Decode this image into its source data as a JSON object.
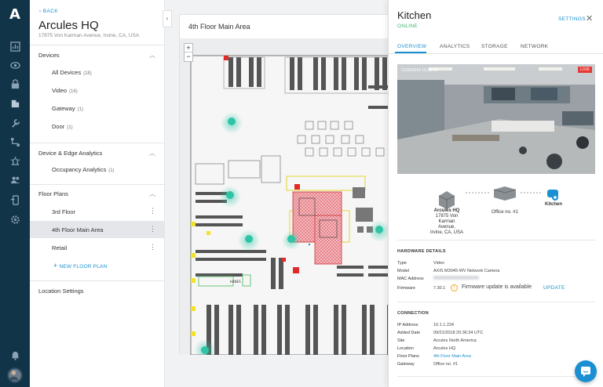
{
  "rail": {
    "logo": "A",
    "icons": [
      "chart-icon",
      "eye-icon",
      "lock-icon",
      "building-icon",
      "wrench-icon",
      "flow-icon",
      "alarm-icon",
      "users-icon",
      "device-icon",
      "gear-icon",
      "bell-icon"
    ]
  },
  "sidebar": {
    "back_label": "BACK",
    "site_name": "Arcules HQ",
    "site_address": "17875 Von Karman Avenue, Irvine, CA, USA",
    "sections": {
      "devices": {
        "title": "Devices",
        "items": [
          {
            "label": "All Devices",
            "count": "(18)"
          },
          {
            "label": "Video",
            "count": "(16)"
          },
          {
            "label": "Gateway",
            "count": "(1)"
          },
          {
            "label": "Door",
            "count": "(1)"
          }
        ]
      },
      "analytics": {
        "title": "Device & Edge Analytics",
        "items": [
          {
            "label": "Occupancy Analytics",
            "count": "(1)"
          }
        ]
      },
      "floor_plans": {
        "title": "Floor Plans",
        "items": [
          {
            "label": "3rd Floor"
          },
          {
            "label": "4th Floor Main Area"
          },
          {
            "label": "Retail"
          }
        ],
        "new_label": "NEW FLOOR PLAN"
      }
    },
    "location_settings": "Location Settings"
  },
  "map": {
    "title": "4th Floor Main Area",
    "zoom_in": "+",
    "zoom_out": "−"
  },
  "panel": {
    "title": "Kitchen",
    "status": "ONLINE",
    "settings_label": "SETTINGS",
    "close": "✕",
    "tabs": [
      "OVERVIEW",
      "ANALYTICS",
      "STORAGE",
      "NETWORK"
    ],
    "video": {
      "live_label": "LIVE",
      "timestamp": "21/09/2018 10:35:43"
    },
    "topology": {
      "site_name": "Arcules HQ",
      "site_addr_1": "17875 Von",
      "site_addr_2": "Karman Avenue,",
      "site_addr_3": "Irvine, CA, USA",
      "gateway": "Office no. #1",
      "camera": "Kitchen"
    },
    "hardware": {
      "title": "HARDWARE DETAILS",
      "type_key": "Type",
      "type_val": "Video",
      "model_key": "Model",
      "model_val": "AXIS M3045-WV Network Camera",
      "mac_key": "MAC Address",
      "firmware_key": "Firmware",
      "firmware_val": "7.30.1",
      "firmware_note": "Firmware update is available",
      "update_label": "UPDATE"
    },
    "connection": {
      "title": "CONNECTION",
      "ip_key": "IP Address",
      "ip_val": "10.1.1.224",
      "added_key": "Added Date",
      "added_val": "09/21/2018 20:36:34 UTC",
      "site_key": "Site",
      "site_val": "Arcules North America",
      "location_key": "Location",
      "location_val": "Arcules HQ",
      "fp_key": "Floor Plans",
      "fp_val": "4th Floor Main Area",
      "gw_key": "Gateway",
      "gw_val": "Office no. #1"
    }
  },
  "colors": {
    "rail": "#123449",
    "accent": "#1b8fd2",
    "online": "#3fb46a",
    "live": "#e53935",
    "camera_marker": "#2ec4a5"
  }
}
